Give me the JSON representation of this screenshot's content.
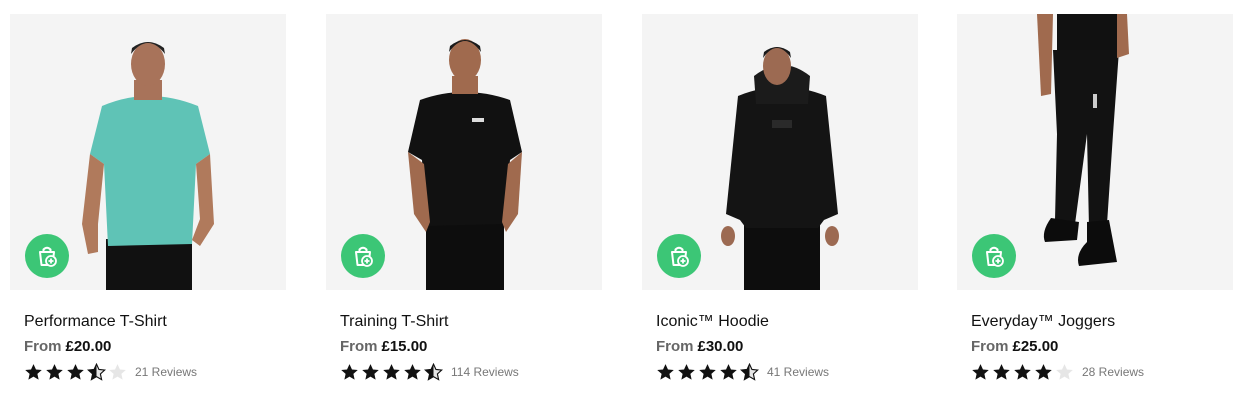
{
  "theme": {
    "accent": "#3cc676",
    "star_filled": "#111111",
    "star_empty": "#e6e6e6",
    "image_bg": "#f4f4f4"
  },
  "products": [
    {
      "name": "Performance T-Shirt",
      "price_prefix": "From",
      "price": "£20.00",
      "rating": 3.5,
      "reviews_label": "21 Reviews",
      "cart_icon": "add-to-basket-icon",
      "image_subject": "model-teal-tshirt"
    },
    {
      "name": "Training T-Shirt",
      "price_prefix": "From",
      "price": "£15.00",
      "rating": 4.5,
      "reviews_label": "114 Reviews",
      "cart_icon": "add-to-basket-icon",
      "image_subject": "model-black-tshirt"
    },
    {
      "name": "Iconic™ Hoodie",
      "price_prefix": "From",
      "price": "£30.00",
      "rating": 4.5,
      "reviews_label": "41 Reviews",
      "cart_icon": "add-to-basket-icon",
      "image_subject": "model-black-hoodie"
    },
    {
      "name": "Everyday™ Joggers",
      "price_prefix": "From",
      "price": "£25.00",
      "rating": 4,
      "reviews_label": "28 Reviews",
      "cart_icon": "add-to-basket-icon",
      "image_subject": "model-black-joggers"
    }
  ]
}
